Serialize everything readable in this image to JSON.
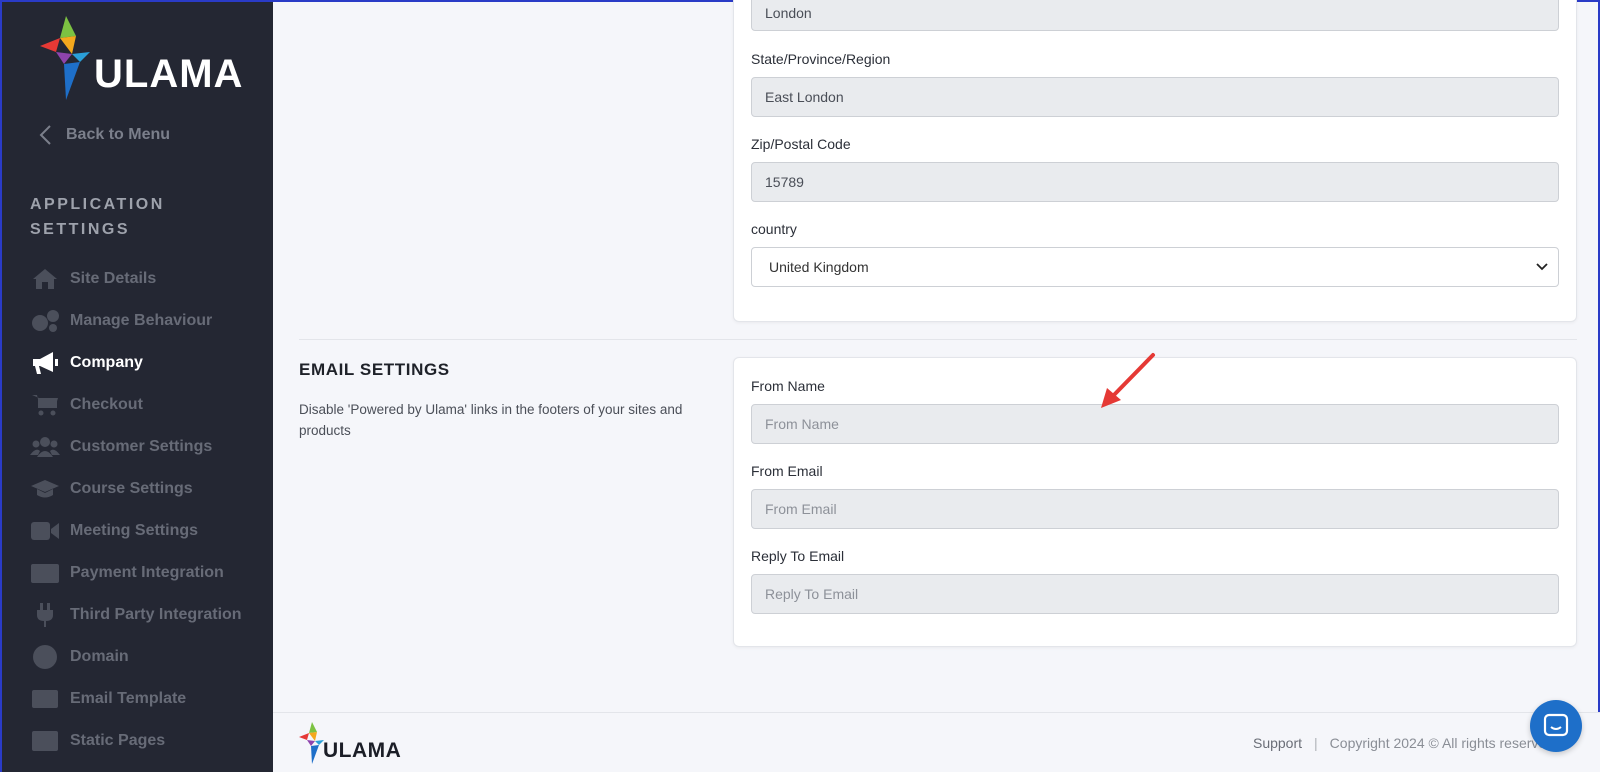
{
  "brand": {
    "name": "ULAMA"
  },
  "sidebar": {
    "back_label": "Back to Menu",
    "section_title": "APPLICATION SETTINGS",
    "items": [
      {
        "label": "Site Details",
        "icon": "home-icon"
      },
      {
        "label": "Manage Behaviour",
        "icon": "gears-icon"
      },
      {
        "label": "Company",
        "icon": "megaphone-icon",
        "active": true
      },
      {
        "label": "Checkout",
        "icon": "cart-icon"
      },
      {
        "label": "Customer Settings",
        "icon": "users-icon"
      },
      {
        "label": "Course Settings",
        "icon": "graduation-cap-icon"
      },
      {
        "label": "Meeting Settings",
        "icon": "video-icon"
      },
      {
        "label": "Payment Integration",
        "icon": "credit-card-icon"
      },
      {
        "label": "Third Party Integration",
        "icon": "plug-icon"
      },
      {
        "label": "Domain",
        "icon": "globe-icon"
      },
      {
        "label": "Email Template",
        "icon": "envelope-icon"
      },
      {
        "label": "Static Pages",
        "icon": "window-icon"
      }
    ]
  },
  "address": {
    "city_value": "London",
    "state_label": "State/Province/Region",
    "state_value": "East London",
    "zip_label": "Zip/Postal Code",
    "zip_value": "15789",
    "country_label": "country",
    "country_value": "United Kingdom"
  },
  "email_settings": {
    "title": "EMAIL SETTINGS",
    "description": "Disable 'Powered by Ulama' links in the footers of your sites and products",
    "from_name_label": "From Name",
    "from_name_placeholder": "From Name",
    "from_email_label": "From Email",
    "from_email_placeholder": "From Email",
    "reply_to_label": "Reply To Email",
    "reply_to_placeholder": "Reply To Email"
  },
  "footer": {
    "support_label": "Support",
    "separator": "|",
    "copyright": "Copyright 2024 © All rights reserved"
  },
  "colors": {
    "sidebar_bg": "#242733",
    "accent_arrow": "#e53935",
    "chat_button": "#1e6fc9"
  }
}
